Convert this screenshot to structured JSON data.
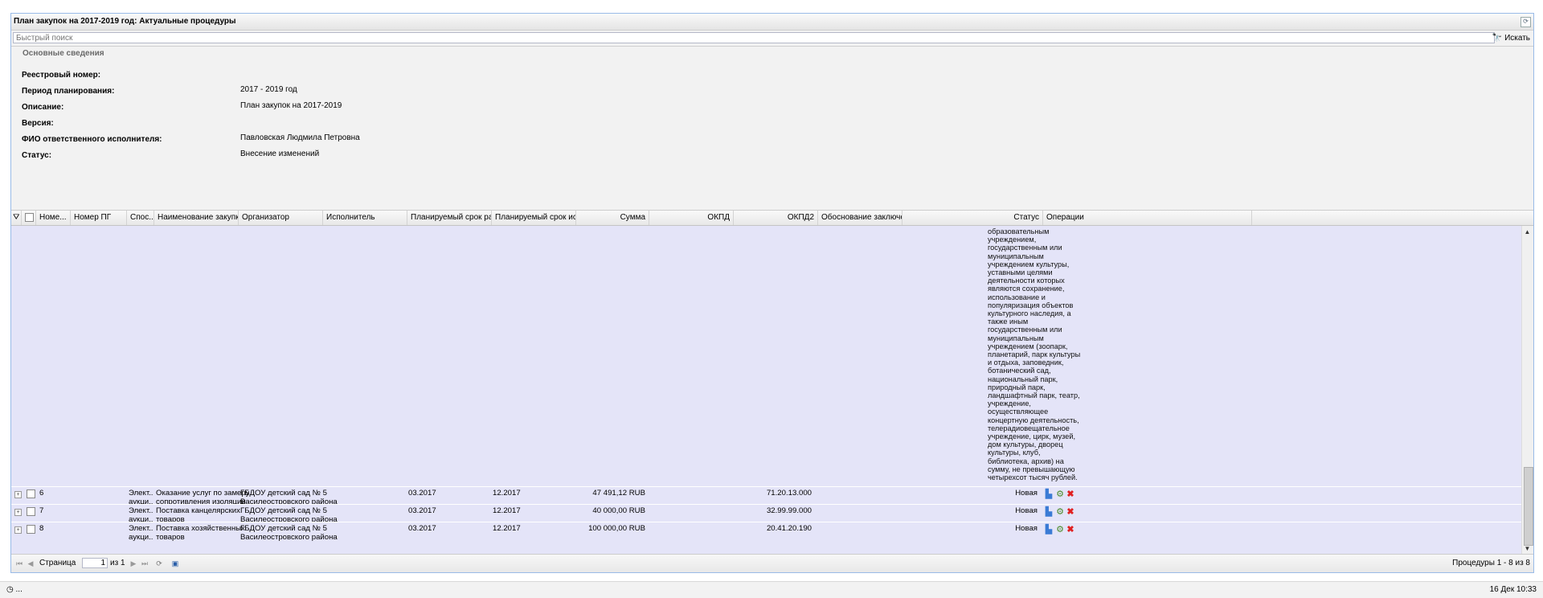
{
  "window": {
    "title": "План закупок на 2017-2019 год: Актуальные процедуры",
    "tool_icon": "refresh-icon"
  },
  "search": {
    "placeholder": "Быстрый поиск",
    "button_label": "Искать",
    "button_icon": "binoculars-icon"
  },
  "info": {
    "legend": "Основные сведения",
    "fields": [
      {
        "label": "Реестровый номер:",
        "value": ""
      },
      {
        "label": "Период планирования:",
        "value": "2017 - 2019 год"
      },
      {
        "label": "Описание:",
        "value": "План закупок на 2017-2019"
      },
      {
        "label": "Версия:",
        "value": ""
      },
      {
        "label": "ФИО ответственного исполнителя:",
        "value": "Павловская Людмила Петровна"
      },
      {
        "label": "Статус:",
        "value": "Внесение изменений"
      }
    ]
  },
  "grid": {
    "columns": {
      "num": "Номе...",
      "pg": "Номер ПГ",
      "method": "Спос...",
      "name": "Наименование закупки",
      "org": "Организатор",
      "exec": "Исполнитель",
      "term1": "Планируемый срок разме...",
      "term2": "Планируемый срок испол...",
      "sum": "Сумма",
      "okpd": "ОКПД",
      "okpd2": "ОКПД2",
      "reason": "Обоснование заключения",
      "status": "Статус",
      "ops": "Операции"
    },
    "long_text_lines": [
      "образовательным",
      "учреждением,",
      "государственным или",
      "муниципальным",
      "учреждением культуры,",
      "уставными целями",
      "деятельности которых",
      "являются сохранение,",
      "использование и",
      "популяризация объектов",
      "культурного наследия, а",
      "также иным",
      "государственным или",
      "муниципальным",
      "учреждением (зоопарк,",
      "планетарий, парк культуры",
      "и отдыха, заповедник,",
      "ботанический сад,",
      "национальный парк,",
      "природный парк,",
      "ландшафтный парк, театр,",
      "учреждение,",
      "осуществляющее",
      "концертную деятельность,",
      "телерадиовещательное",
      "учреждение, цирк, музей,",
      "дом культуры, дворец",
      "культуры, клуб,",
      "библиотека, архив) на",
      "сумму, не превышающую",
      "четырехсот тысяч рублей."
    ],
    "rows": [
      {
        "num": "6",
        "method1": "Элект...",
        "method2": "аукци...",
        "name1": "Оказание услуг по замеру",
        "name2": "сопротивления изоляции",
        "org1": "ГБДОУ детский сад № 5",
        "org2": "Василеостровского района",
        "term1": "03.2017",
        "term2": "12.2017",
        "sum": "47 491,12 RUB",
        "okpd2": "71.20.13.000",
        "status": "Новая"
      },
      {
        "num": "7",
        "method1": "Элект...",
        "method2": "аукци...",
        "name1": "Поставка канцелярских",
        "name2": "товаров",
        "org1": "ГБДОУ детский сад № 5",
        "org2": "Василеостровского района",
        "term1": "03.2017",
        "term2": "12.2017",
        "sum": "40 000,00 RUB",
        "okpd2": "32.99.99.000",
        "status": "Новая"
      },
      {
        "num": "8",
        "method1": "Элект...",
        "method2": "аукци...",
        "name1": "Поставка хозяйственных",
        "name2": "товаров",
        "org1": "ГБДОУ детский сад № 5",
        "org2": "Василеостровского района",
        "term1": "03.2017",
        "term2": "12.2017",
        "sum": "100 000,00 RUB",
        "okpd2": "20.41.20.190",
        "status": "Новая"
      }
    ]
  },
  "pager": {
    "page_label": "Страница",
    "page_value": "1",
    "of_label": "из 1",
    "summary": "Процедуры 1 - 8 из 8"
  },
  "statusbar": {
    "left": "...",
    "datetime": "16 Дек 10:33"
  }
}
